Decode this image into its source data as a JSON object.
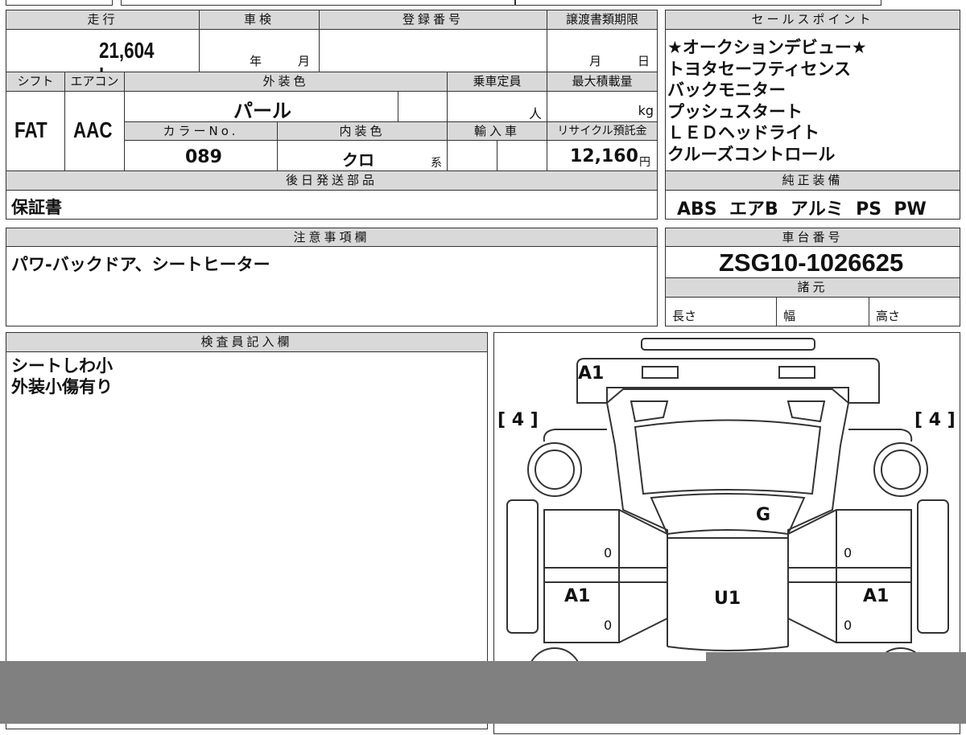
{
  "headers": {
    "mileage": "走行",
    "inspection": "車検",
    "reg_number": "登録番号",
    "transfer_deadline": "譲渡書類期限",
    "shift": "シフト",
    "aircon": "エアコン",
    "ext_color": "外装色",
    "capacity": "乗車定員",
    "max_load": "最大積載量",
    "color_no": "カラーNo.",
    "int_color": "内装色",
    "import": "輸入車",
    "recycle": "リサイクル預託金",
    "later_parts": "後日発送部品",
    "sales_points": "セールスポイント",
    "equipment": "純正装備",
    "notes": "注意事項欄",
    "chassis": "車台番号",
    "specs": "諸元",
    "inspector": "検査員記入欄"
  },
  "values": {
    "mileage": "21,604 km",
    "year_unit": "年",
    "month_unit": "月",
    "day_unit": "日",
    "shift": "FAT",
    "aircon": "AAC",
    "ext_color": "パール",
    "capacity_unit": "人",
    "load_unit": "kg",
    "color_no": "089",
    "int_color": "クロ",
    "int_suffix": "系",
    "recycle": "12,160",
    "yen": "円",
    "later_parts": "保証書",
    "equipment": "ABS  エアB  アルミ  PS  PW",
    "notes": "パワ-バックドア、シートヒーター",
    "chassis": "ZSG10-1026625",
    "length": "長さ",
    "width": "幅",
    "height": "高さ"
  },
  "sales_points": [
    "★オークションデビュー★",
    "トヨタセーフティセンス",
    "バックモニター",
    "プッシュスタート",
    "ＬＥＤヘッドライト",
    "クルーズコントロール"
  ],
  "inspector_notes": [
    "シートしわ小",
    "外装小傷有り"
  ],
  "diagram": {
    "front": "A1",
    "left_tire": "[ 4 ]",
    "right_tire": "[ 4 ]",
    "windshield": "G",
    "roof": "U1",
    "left_door": "A1",
    "right_door": "A1",
    "zero": "0"
  }
}
